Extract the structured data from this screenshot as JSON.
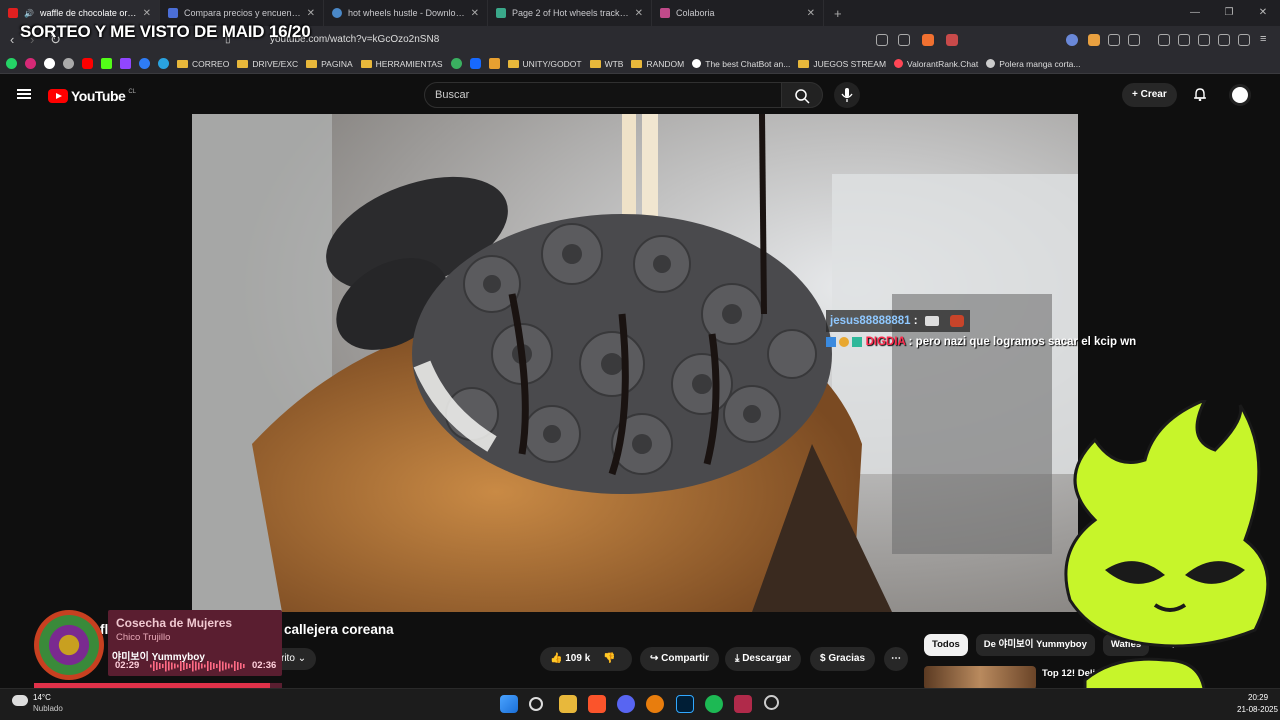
{
  "browser": {
    "tabs": [
      {
        "label": "waffle de chocolate oreo - co",
        "active": true,
        "color": "#e02020"
      },
      {
        "label": "Compara precios y encuentra ofertas",
        "active": false,
        "color": "#4b6ed6"
      },
      {
        "label": "hot wheels hustle - Download Free 3",
        "active": false,
        "color": "#4a88c8"
      },
      {
        "label": "Page 2 of Hot wheels track 3D Mode",
        "active": false,
        "color": "#3aa88a"
      },
      {
        "label": "Colaboria",
        "active": false,
        "color": "#c04a8a"
      }
    ],
    "new_tab": "+",
    "window_controls": [
      "—",
      "❐",
      "✕"
    ],
    "url": "youtube.com/watch?v=kGcOzo2nSN8",
    "bookmarks": [
      {
        "label": "CORREO",
        "type": "folder"
      },
      {
        "label": "DRIVE/EXC",
        "type": "folder"
      },
      {
        "label": "PAGINA",
        "type": "folder"
      },
      {
        "label": "HERRAMIENTAS",
        "type": "folder"
      },
      {
        "label": "UNITY/GODOT",
        "type": "folder"
      },
      {
        "label": "WTB",
        "type": "folder"
      },
      {
        "label": "RANDOM",
        "type": "folder"
      },
      {
        "label": "The best ChatBot an...",
        "type": "link"
      },
      {
        "label": "JUEGOS STREAM",
        "type": "folder"
      },
      {
        "label": "ValorantRank.Chat",
        "type": "link"
      },
      {
        "label": "Polera manga corta...",
        "type": "link"
      }
    ]
  },
  "stream_overlay": {
    "title": "SORTEO Y ME VISTO DE MAID 16/20",
    "chat": [
      {
        "user": "jesus88888881",
        "sep": " :",
        "message": ""
      },
      {
        "user": "DIGDIA",
        "sep": " :",
        "message": "pero nazi que logramos sacar el kcip wn"
      }
    ]
  },
  "youtube": {
    "logo": "YouTube",
    "country": "CL",
    "search_placeholder": "Buscar",
    "create_label": "Crear",
    "video_title": "callejera coreana",
    "video_title_prefix": "fl",
    "channel": "야미보이 Yummyboy",
    "subscribed_label": "crito",
    "likes": "109 k",
    "share": "Compartir",
    "download": "Descargar",
    "thanks": "Gracias",
    "more": "⋯",
    "chips": [
      "Todos",
      "De 야미보이 Yummyboy",
      "Wafles"
    ],
    "rec_title": "Top 12! Delic comida call"
  },
  "spotify": {
    "title": "Cosecha de Mujeres",
    "artist": "Chico Trujillo",
    "elapsed": "02:29",
    "total": "02:36",
    "progress": 0.95
  },
  "taskbar": {
    "temperature": "14°C",
    "weather": "Nublado",
    "time": "20:29",
    "date": "21-08-2025"
  }
}
